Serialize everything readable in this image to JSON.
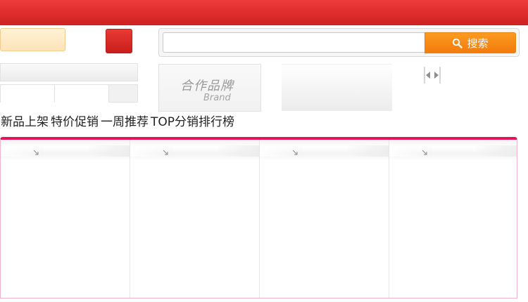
{
  "search": {
    "placeholder": "",
    "value": "",
    "button_label": "搜索"
  },
  "brand": {
    "title_cn": "合作品牌",
    "title_en": "Brand"
  },
  "nav": {
    "links": [
      "新品上架",
      "特价促销",
      "一周推荐",
      "TOP分销排行榜"
    ]
  },
  "colors": {
    "topbar": "#d92a2a",
    "search_button": "#f68613",
    "panel_accent": "#e4145a"
  },
  "icons": {
    "search": "magnifier-icon",
    "carousel_prev": "arrow-left-icon",
    "carousel_next": "arrow-right-icon",
    "column_corner": "corner-arrow-icon"
  }
}
